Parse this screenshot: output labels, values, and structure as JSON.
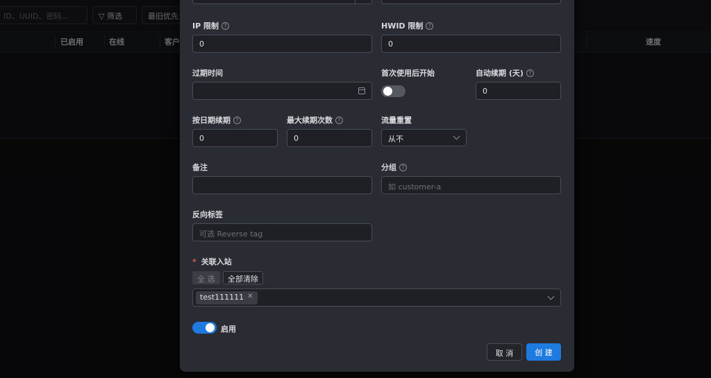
{
  "background": {
    "search_placeholder": "ID、UUID、密码...",
    "filter_label": "筛选",
    "sort_label": "最旧优先",
    "columns": [
      "已启用",
      "在线",
      "客户",
      "速度"
    ]
  },
  "form": {
    "ip_limit": {
      "label": "IP 限制",
      "value": "0"
    },
    "hwid_limit": {
      "label": "HWID 限制",
      "value": "0"
    },
    "expiry_time": {
      "label": "过期时间",
      "value": ""
    },
    "start_after_first_use": {
      "label": "首次使用后开始",
      "enabled": false
    },
    "auto_renew_days": {
      "label": "自动续期 (天)",
      "value": "0"
    },
    "renew_by_date": {
      "label": "按日期续期",
      "value": "0"
    },
    "max_renewals": {
      "label": "最大续期次数",
      "value": "0"
    },
    "traffic_reset": {
      "label": "流量重置",
      "value": "从不"
    },
    "remark": {
      "label": "备注",
      "value": ""
    },
    "group": {
      "label": "分组",
      "placeholder": "如 customer-a"
    },
    "reverse_tag": {
      "label": "反向标签",
      "placeholder": "可选 Reverse tag"
    },
    "inbounds": {
      "label": "关联入站",
      "select_all_label": "全 选",
      "clear_all_label": "全部清除",
      "selected": [
        "test111111"
      ]
    },
    "enable": {
      "label": "启用",
      "enabled": true
    }
  },
  "footer": {
    "cancel_label": "取 消",
    "create_label": "创 建"
  },
  "colors": {
    "accent": "#1f7ae0",
    "modal_bg": "#2a2c33",
    "required": "#e05b5b"
  }
}
